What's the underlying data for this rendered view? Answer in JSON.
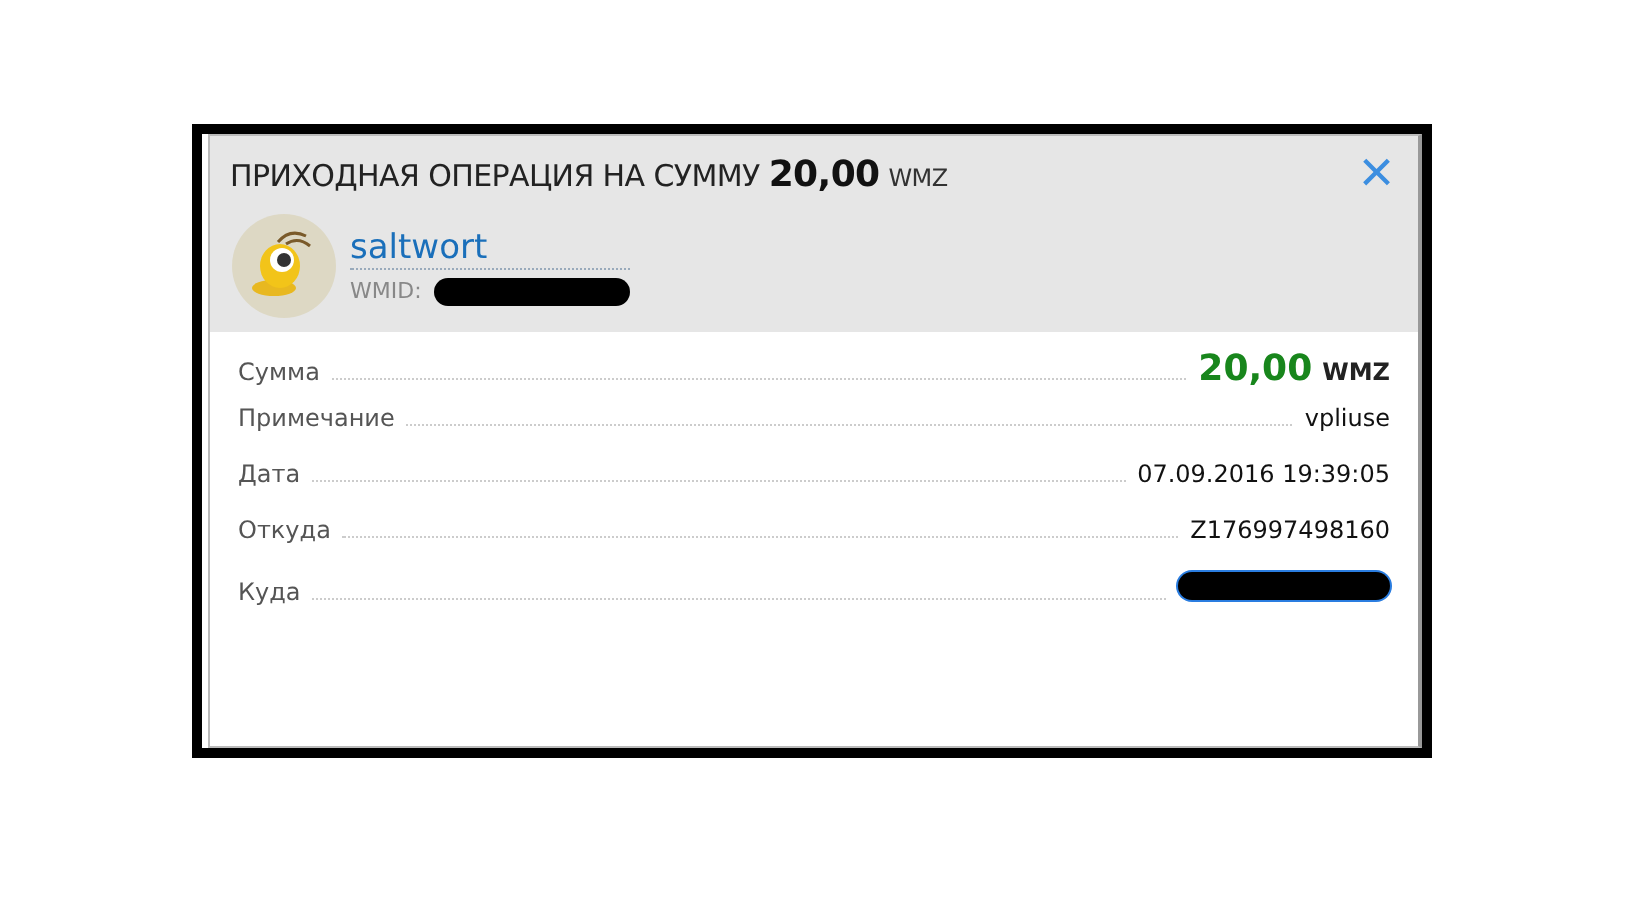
{
  "dialog": {
    "title": "ПРИХОДНАЯ ОПЕРАЦИЯ НА СУММУ",
    "amount": "20,00",
    "currency": "WMZ",
    "close": "×"
  },
  "sender": {
    "name": "saltwort",
    "wmid_label": "WMID:"
  },
  "rows": [
    {
      "kind": "amount",
      "label": "Сумма",
      "value": "20,00",
      "currency": "WMZ"
    },
    {
      "kind": "text",
      "label": "Примечание",
      "value": "vpliuse"
    },
    {
      "kind": "text",
      "label": "Дата",
      "value": "07.09.2016 19:39:05"
    },
    {
      "kind": "text",
      "label": "Откуда",
      "value": "Z176997498160"
    },
    {
      "kind": "redacted",
      "label": "Куда"
    }
  ]
}
